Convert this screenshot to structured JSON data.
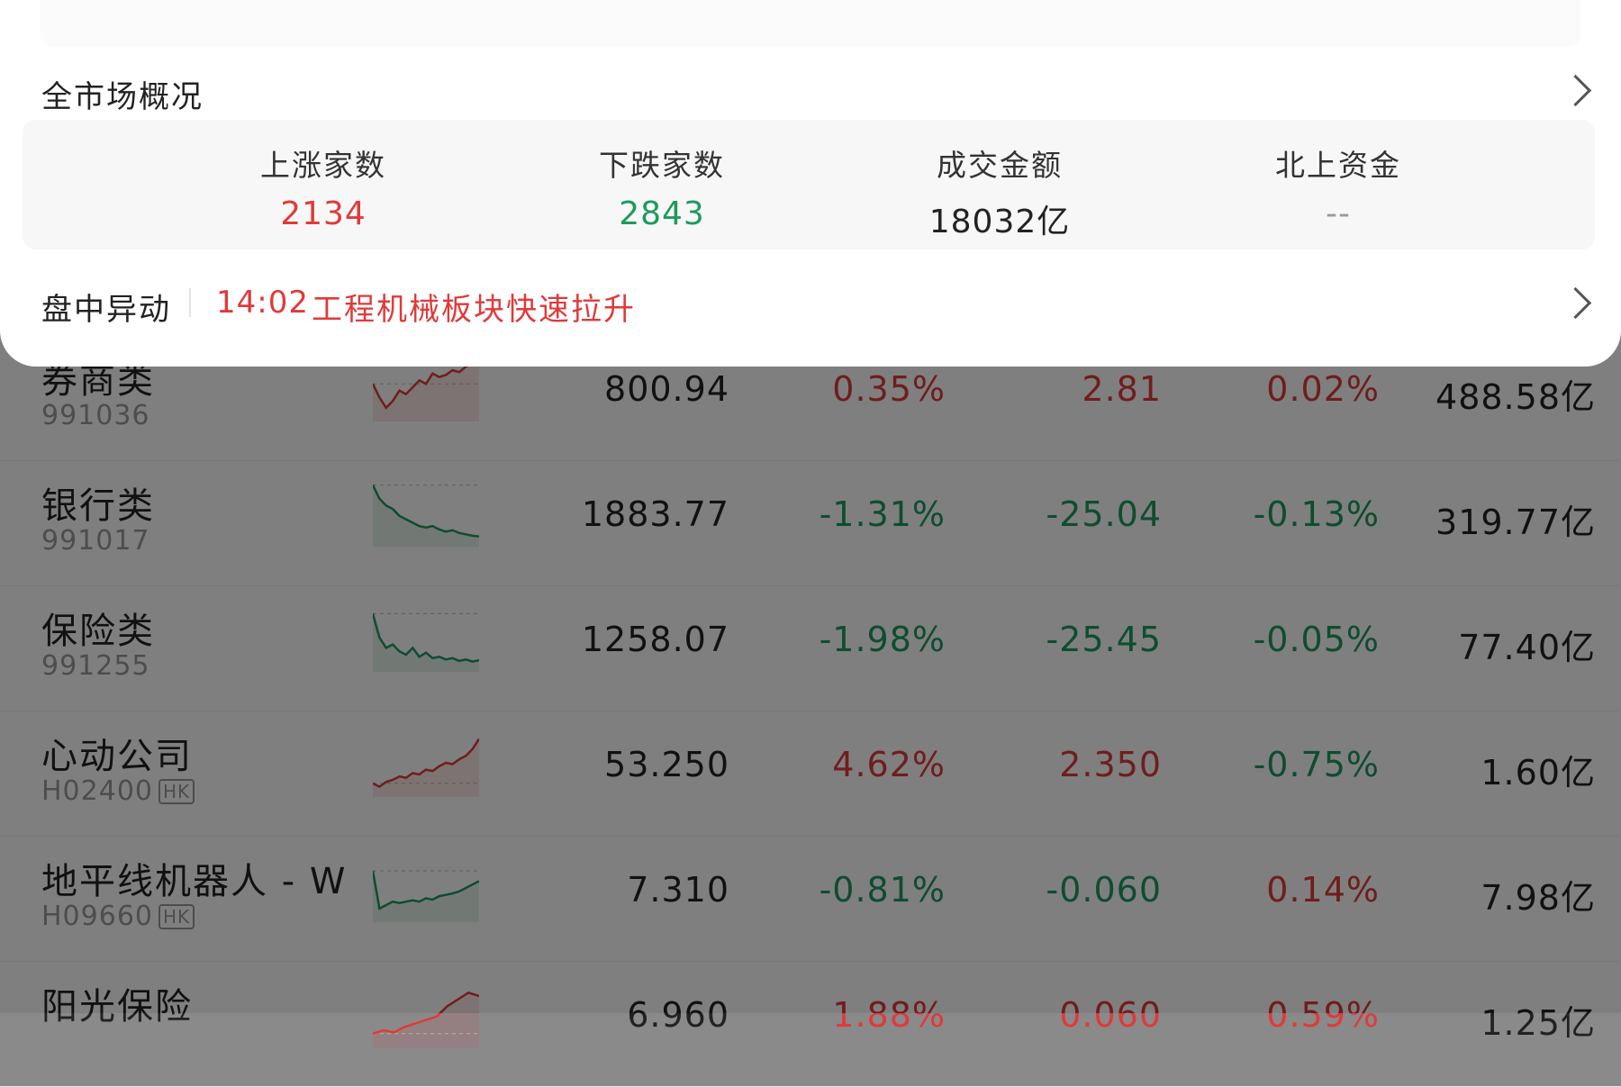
{
  "market_overview": {
    "title": "全市场概况",
    "stats": [
      {
        "label": "上涨家数",
        "value": "2134",
        "tone": "up"
      },
      {
        "label": "下跌家数",
        "value": "2843",
        "tone": "down"
      },
      {
        "label": "成交金额",
        "value": "18032亿",
        "tone": "neutral"
      },
      {
        "label": "北上资金",
        "value": "--",
        "tone": "dash"
      }
    ]
  },
  "intraday": {
    "label": "盘中异动",
    "time": "14:02",
    "text": "工程机械板块快速拉升"
  },
  "stocks": [
    {
      "name": "券商类",
      "code": "991036",
      "tag": "",
      "price": "800.94",
      "pct": "0.35%",
      "change": "2.81",
      "speed": "0.02%",
      "volume": "488.58亿",
      "trend": "up",
      "spark": [
        0.55,
        0.35,
        0.2,
        0.3,
        0.45,
        0.4,
        0.5,
        0.6,
        0.55,
        0.7,
        0.65,
        0.68,
        0.75,
        0.72,
        0.8,
        0.85,
        0.9
      ]
    },
    {
      "name": "银行类",
      "code": "991017",
      "tag": "",
      "price": "1883.77",
      "pct": "-1.31%",
      "change": "-25.04",
      "speed": "-0.13%",
      "volume": "319.77亿",
      "trend": "down",
      "spark": [
        0.9,
        0.7,
        0.6,
        0.55,
        0.45,
        0.4,
        0.35,
        0.3,
        0.28,
        0.3,
        0.25,
        0.22,
        0.24,
        0.2,
        0.18,
        0.16,
        0.15
      ]
    },
    {
      "name": "保险类",
      "code": "991255",
      "tag": "",
      "price": "1258.07",
      "pct": "-1.98%",
      "change": "-25.45",
      "speed": "-0.05%",
      "volume": "77.40亿",
      "trend": "down",
      "spark": [
        0.85,
        0.5,
        0.35,
        0.4,
        0.3,
        0.25,
        0.35,
        0.22,
        0.28,
        0.2,
        0.22,
        0.18,
        0.2,
        0.16,
        0.18,
        0.15,
        0.17
      ]
    },
    {
      "name": "心动公司",
      "code": "H02400",
      "tag": "HK",
      "price": "53.250",
      "pct": "4.62%",
      "change": "2.350",
      "speed": "-0.75%",
      "volume": "1.60亿",
      "trend": "up",
      "spark": [
        0.2,
        0.15,
        0.22,
        0.25,
        0.3,
        0.28,
        0.35,
        0.33,
        0.4,
        0.38,
        0.45,
        0.5,
        0.48,
        0.55,
        0.6,
        0.7,
        0.85
      ]
    },
    {
      "name": "地平线机器人 - W",
      "code": "H09660",
      "tag": "HK",
      "price": "7.310",
      "pct": "-0.81%",
      "change": "-0.060",
      "speed": "0.14%",
      "volume": "7.98亿",
      "trend": "down",
      "spark": [
        0.75,
        0.2,
        0.25,
        0.3,
        0.28,
        0.3,
        0.32,
        0.3,
        0.35,
        0.33,
        0.38,
        0.4,
        0.42,
        0.45,
        0.5,
        0.55,
        0.6
      ]
    },
    {
      "name": "阳光保险",
      "code": "",
      "tag": "",
      "price": "6.960",
      "pct": "1.88%",
      "change": "0.060",
      "speed": "0.59%",
      "volume": "1.25亿",
      "trend": "up",
      "spark": [
        0.2,
        0.25,
        0.22,
        0.3,
        0.35,
        0.4,
        0.45,
        0.6,
        0.7,
        0.8,
        0.75
      ]
    }
  ],
  "colors": {
    "up": "#e03a3a",
    "down": "#1d9a5c",
    "overlay": "rgba(0,0,0,0.5)"
  }
}
